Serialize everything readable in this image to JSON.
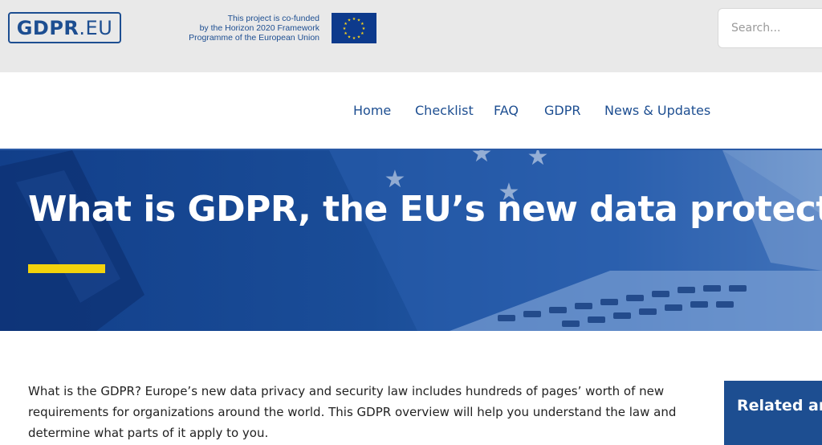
{
  "header": {
    "logo_bold": "GDPR",
    "logo_ext": ".EU",
    "cofund_lines": [
      "This project is co-funded",
      "by the Horizon 2020 Framework",
      "Programme of the European Union"
    ],
    "flag_icon": "eu-flag-icon",
    "search": {
      "placeholder": "Search..."
    }
  },
  "nav": {
    "items": [
      {
        "label": "Home"
      },
      {
        "label": "Checklist"
      },
      {
        "label": "FAQ"
      },
      {
        "label": "GDPR"
      },
      {
        "label": "News & Updates"
      }
    ]
  },
  "hero": {
    "title": "What is GDPR, the EU’s new data protection law?",
    "accent_color": "#f2d30c"
  },
  "article": {
    "intro": "What is the GDPR? Europe’s new data privacy and security law includes hundreds of pages’ worth of new requirements for organizations around the world. This GDPR overview will help you understand the law and determine what parts of it apply to you."
  },
  "sidebar": {
    "related_title": "Related articles"
  },
  "colors": {
    "brand_blue": "#1d4e91",
    "topbar_bg": "#e9e9e9"
  }
}
